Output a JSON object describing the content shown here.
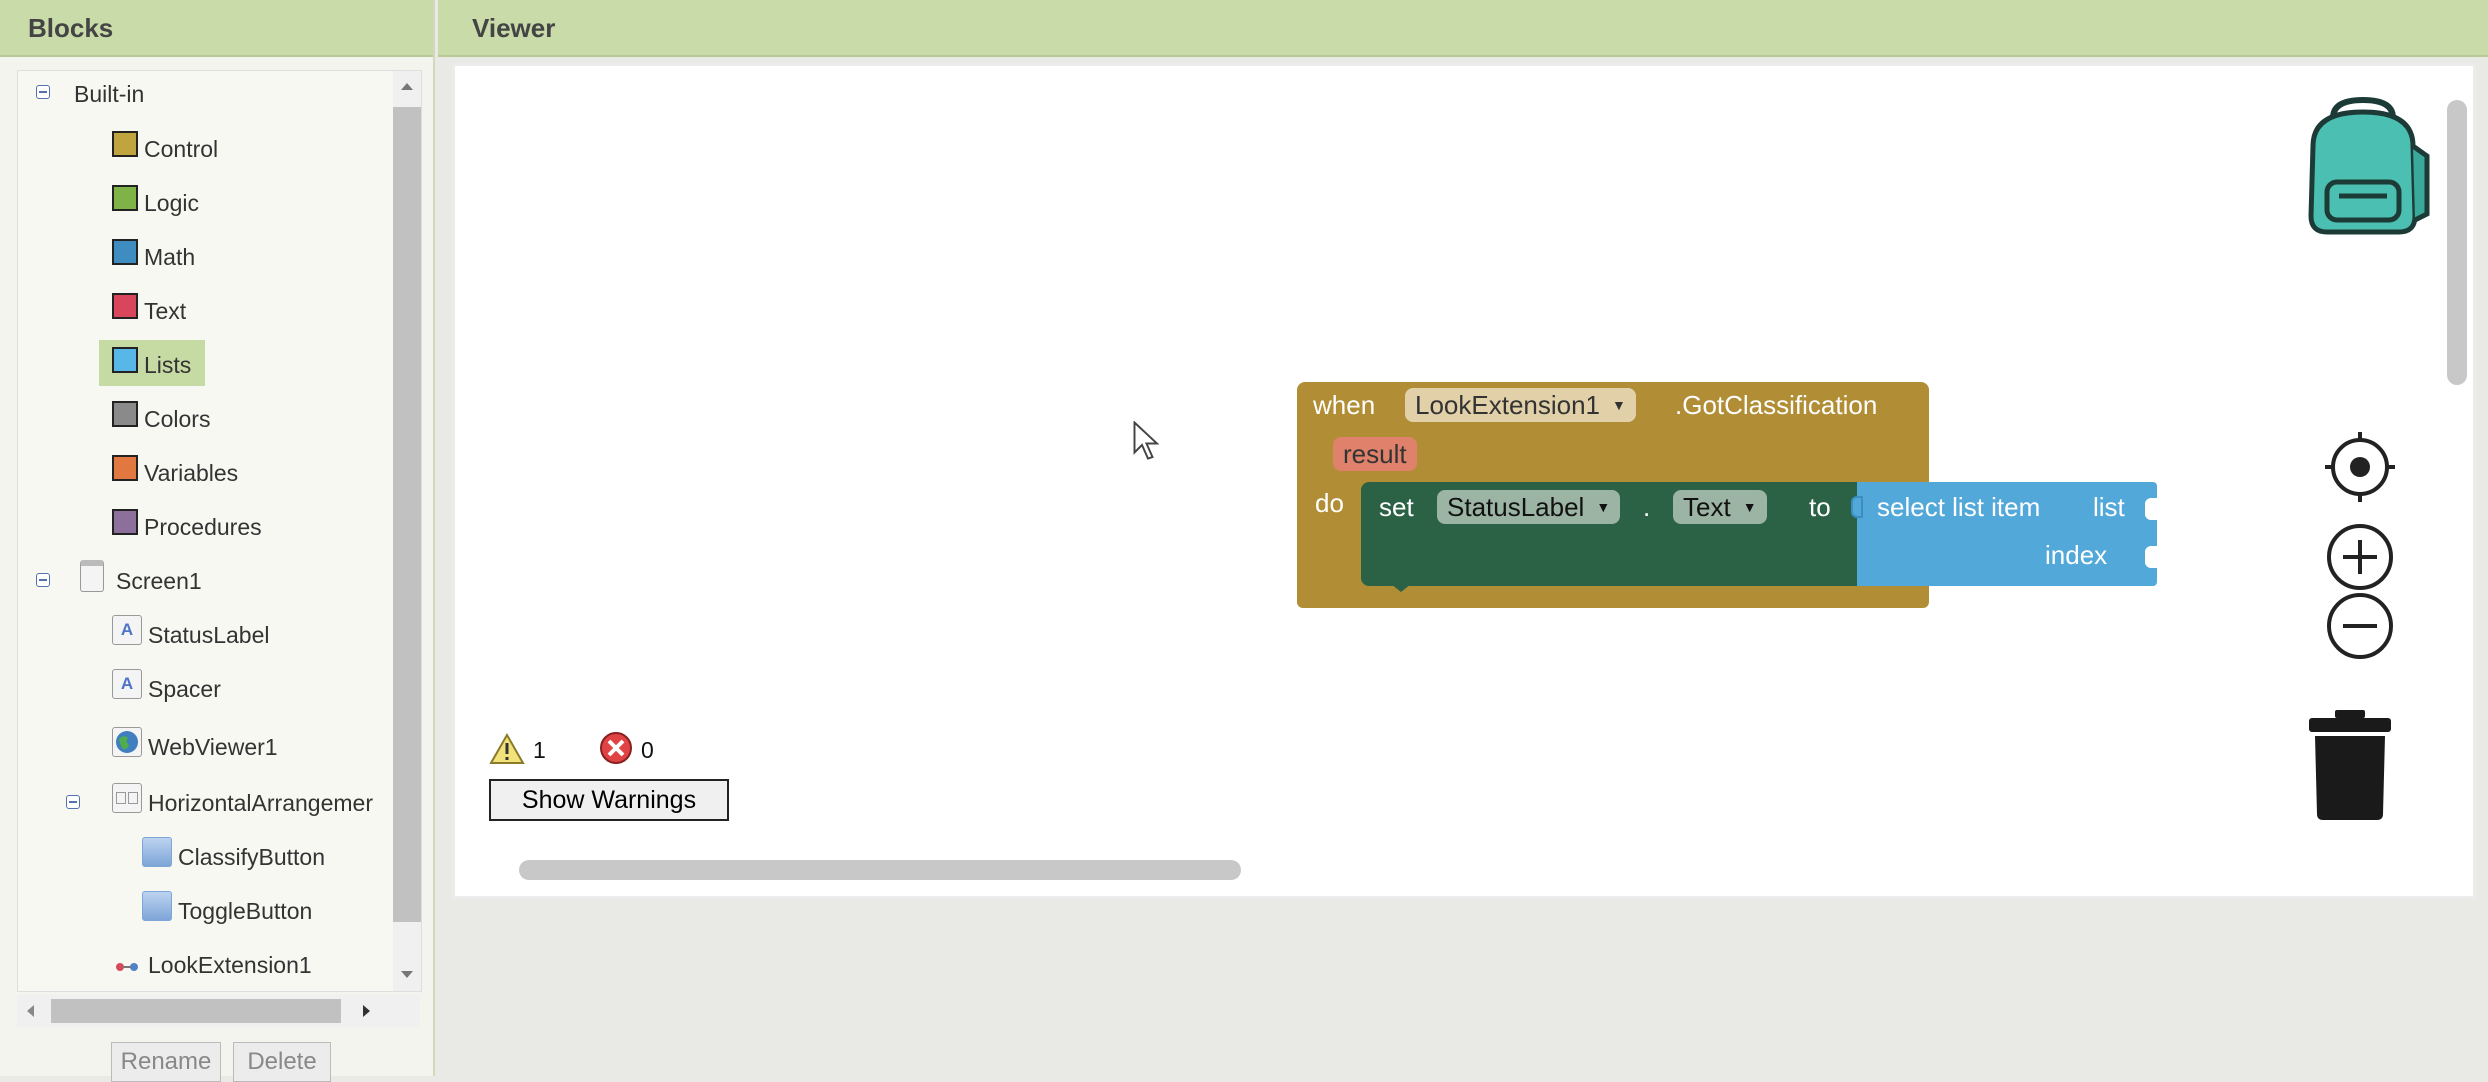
{
  "blocks_panel": {
    "title": "Blocks",
    "builtin_label": "Built-in",
    "builtin_items": [
      {
        "label": "Control",
        "color": "#c0a43f"
      },
      {
        "label": "Logic",
        "color": "#7fb347"
      },
      {
        "label": "Math",
        "color": "#3f8cc0"
      },
      {
        "label": "Text",
        "color": "#d9455b"
      },
      {
        "label": "Lists",
        "color": "#57b7e6"
      },
      {
        "label": "Colors",
        "color": "#8a8a8a"
      },
      {
        "label": "Variables",
        "color": "#e07840"
      },
      {
        "label": "Procedures",
        "color": "#8c6f9b"
      }
    ],
    "selected_item": "Lists",
    "screen_label": "Screen1",
    "components": {
      "status_label": "StatusLabel",
      "spacer": "Spacer",
      "webviewer": "WebViewer1",
      "horizontal_arrangement": "HorizontalArrangemer",
      "classify_button": "ClassifyButton",
      "toggle_button": "ToggleButton",
      "look_extension": "LookExtension1"
    },
    "rename_button": "Rename",
    "delete_button": "Delete"
  },
  "viewer": {
    "title": "Viewer",
    "event_block": {
      "when": "when",
      "component": "LookExtension1",
      "event": ".GotClassification",
      "param": "result",
      "do": "do"
    },
    "set_block": {
      "set": "set",
      "component": "StatusLabel",
      "dot": ".",
      "property": "Text",
      "to": "to"
    },
    "select_block": {
      "label": "select list item",
      "list": "list",
      "index": "index"
    },
    "warning_count": "1",
    "error_count": "0",
    "show_warnings_button": "Show Warnings"
  }
}
